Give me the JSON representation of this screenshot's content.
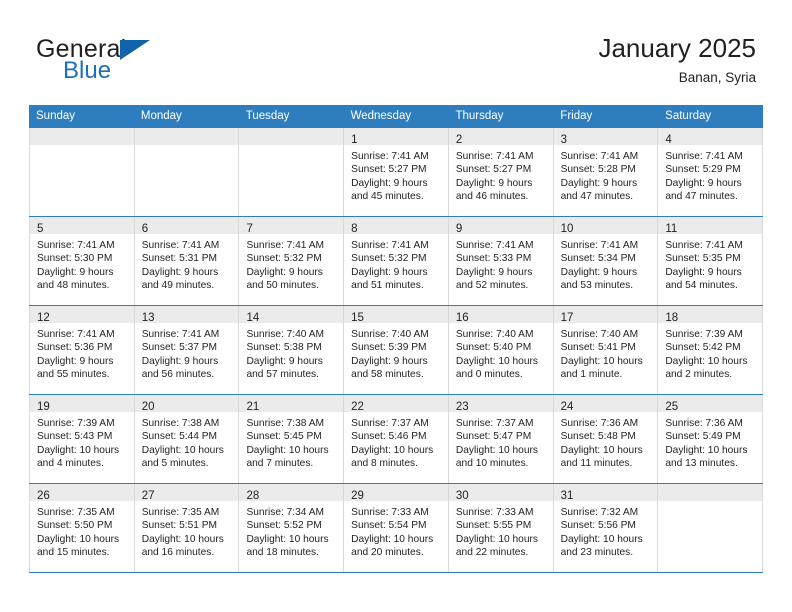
{
  "brand": {
    "name_top": "General",
    "name_bottom": "Blue",
    "accent_color": "#1163ac"
  },
  "header": {
    "title": "January 2025",
    "subtitle": "Banan, Syria"
  },
  "theme": {
    "header_blue": "#2e7ebf",
    "daynum_strip": "#ebebeb",
    "grid_line": "#d9d9d9",
    "text": "#231f20"
  },
  "calendar": {
    "day_names": [
      "Sunday",
      "Monday",
      "Tuesday",
      "Wednesday",
      "Thursday",
      "Friday",
      "Saturday"
    ],
    "labels": {
      "sunrise": "Sunrise:",
      "sunset": "Sunset:",
      "daylight": "Daylight:"
    },
    "weeks": [
      [
        {
          "day": "",
          "sunrise": "",
          "sunset": "",
          "daylight_1": "",
          "daylight_2": ""
        },
        {
          "day": "",
          "sunrise": "",
          "sunset": "",
          "daylight_1": "",
          "daylight_2": ""
        },
        {
          "day": "",
          "sunrise": "",
          "sunset": "",
          "daylight_1": "",
          "daylight_2": ""
        },
        {
          "day": "1",
          "sunrise": "Sunrise: 7:41 AM",
          "sunset": "Sunset: 5:27 PM",
          "daylight_1": "Daylight: 9 hours",
          "daylight_2": "and 45 minutes."
        },
        {
          "day": "2",
          "sunrise": "Sunrise: 7:41 AM",
          "sunset": "Sunset: 5:27 PM",
          "daylight_1": "Daylight: 9 hours",
          "daylight_2": "and 46 minutes."
        },
        {
          "day": "3",
          "sunrise": "Sunrise: 7:41 AM",
          "sunset": "Sunset: 5:28 PM",
          "daylight_1": "Daylight: 9 hours",
          "daylight_2": "and 47 minutes."
        },
        {
          "day": "4",
          "sunrise": "Sunrise: 7:41 AM",
          "sunset": "Sunset: 5:29 PM",
          "daylight_1": "Daylight: 9 hours",
          "daylight_2": "and 47 minutes."
        }
      ],
      [
        {
          "day": "5",
          "sunrise": "Sunrise: 7:41 AM",
          "sunset": "Sunset: 5:30 PM",
          "daylight_1": "Daylight: 9 hours",
          "daylight_2": "and 48 minutes."
        },
        {
          "day": "6",
          "sunrise": "Sunrise: 7:41 AM",
          "sunset": "Sunset: 5:31 PM",
          "daylight_1": "Daylight: 9 hours",
          "daylight_2": "and 49 minutes."
        },
        {
          "day": "7",
          "sunrise": "Sunrise: 7:41 AM",
          "sunset": "Sunset: 5:32 PM",
          "daylight_1": "Daylight: 9 hours",
          "daylight_2": "and 50 minutes."
        },
        {
          "day": "8",
          "sunrise": "Sunrise: 7:41 AM",
          "sunset": "Sunset: 5:32 PM",
          "daylight_1": "Daylight: 9 hours",
          "daylight_2": "and 51 minutes."
        },
        {
          "day": "9",
          "sunrise": "Sunrise: 7:41 AM",
          "sunset": "Sunset: 5:33 PM",
          "daylight_1": "Daylight: 9 hours",
          "daylight_2": "and 52 minutes."
        },
        {
          "day": "10",
          "sunrise": "Sunrise: 7:41 AM",
          "sunset": "Sunset: 5:34 PM",
          "daylight_1": "Daylight: 9 hours",
          "daylight_2": "and 53 minutes."
        },
        {
          "day": "11",
          "sunrise": "Sunrise: 7:41 AM",
          "sunset": "Sunset: 5:35 PM",
          "daylight_1": "Daylight: 9 hours",
          "daylight_2": "and 54 minutes."
        }
      ],
      [
        {
          "day": "12",
          "sunrise": "Sunrise: 7:41 AM",
          "sunset": "Sunset: 5:36 PM",
          "daylight_1": "Daylight: 9 hours",
          "daylight_2": "and 55 minutes."
        },
        {
          "day": "13",
          "sunrise": "Sunrise: 7:41 AM",
          "sunset": "Sunset: 5:37 PM",
          "daylight_1": "Daylight: 9 hours",
          "daylight_2": "and 56 minutes."
        },
        {
          "day": "14",
          "sunrise": "Sunrise: 7:40 AM",
          "sunset": "Sunset: 5:38 PM",
          "daylight_1": "Daylight: 9 hours",
          "daylight_2": "and 57 minutes."
        },
        {
          "day": "15",
          "sunrise": "Sunrise: 7:40 AM",
          "sunset": "Sunset: 5:39 PM",
          "daylight_1": "Daylight: 9 hours",
          "daylight_2": "and 58 minutes."
        },
        {
          "day": "16",
          "sunrise": "Sunrise: 7:40 AM",
          "sunset": "Sunset: 5:40 PM",
          "daylight_1": "Daylight: 10 hours",
          "daylight_2": "and 0 minutes."
        },
        {
          "day": "17",
          "sunrise": "Sunrise: 7:40 AM",
          "sunset": "Sunset: 5:41 PM",
          "daylight_1": "Daylight: 10 hours",
          "daylight_2": "and 1 minute."
        },
        {
          "day": "18",
          "sunrise": "Sunrise: 7:39 AM",
          "sunset": "Sunset: 5:42 PM",
          "daylight_1": "Daylight: 10 hours",
          "daylight_2": "and 2 minutes."
        }
      ],
      [
        {
          "day": "19",
          "sunrise": "Sunrise: 7:39 AM",
          "sunset": "Sunset: 5:43 PM",
          "daylight_1": "Daylight: 10 hours",
          "daylight_2": "and 4 minutes."
        },
        {
          "day": "20",
          "sunrise": "Sunrise: 7:38 AM",
          "sunset": "Sunset: 5:44 PM",
          "daylight_1": "Daylight: 10 hours",
          "daylight_2": "and 5 minutes."
        },
        {
          "day": "21",
          "sunrise": "Sunrise: 7:38 AM",
          "sunset": "Sunset: 5:45 PM",
          "daylight_1": "Daylight: 10 hours",
          "daylight_2": "and 7 minutes."
        },
        {
          "day": "22",
          "sunrise": "Sunrise: 7:37 AM",
          "sunset": "Sunset: 5:46 PM",
          "daylight_1": "Daylight: 10 hours",
          "daylight_2": "and 8 minutes."
        },
        {
          "day": "23",
          "sunrise": "Sunrise: 7:37 AM",
          "sunset": "Sunset: 5:47 PM",
          "daylight_1": "Daylight: 10 hours",
          "daylight_2": "and 10 minutes."
        },
        {
          "day": "24",
          "sunrise": "Sunrise: 7:36 AM",
          "sunset": "Sunset: 5:48 PM",
          "daylight_1": "Daylight: 10 hours",
          "daylight_2": "and 11 minutes."
        },
        {
          "day": "25",
          "sunrise": "Sunrise: 7:36 AM",
          "sunset": "Sunset: 5:49 PM",
          "daylight_1": "Daylight: 10 hours",
          "daylight_2": "and 13 minutes."
        }
      ],
      [
        {
          "day": "26",
          "sunrise": "Sunrise: 7:35 AM",
          "sunset": "Sunset: 5:50 PM",
          "daylight_1": "Daylight: 10 hours",
          "daylight_2": "and 15 minutes."
        },
        {
          "day": "27",
          "sunrise": "Sunrise: 7:35 AM",
          "sunset": "Sunset: 5:51 PM",
          "daylight_1": "Daylight: 10 hours",
          "daylight_2": "and 16 minutes."
        },
        {
          "day": "28",
          "sunrise": "Sunrise: 7:34 AM",
          "sunset": "Sunset: 5:52 PM",
          "daylight_1": "Daylight: 10 hours",
          "daylight_2": "and 18 minutes."
        },
        {
          "day": "29",
          "sunrise": "Sunrise: 7:33 AM",
          "sunset": "Sunset: 5:54 PM",
          "daylight_1": "Daylight: 10 hours",
          "daylight_2": "and 20 minutes."
        },
        {
          "day": "30",
          "sunrise": "Sunrise: 7:33 AM",
          "sunset": "Sunset: 5:55 PM",
          "daylight_1": "Daylight: 10 hours",
          "daylight_2": "and 22 minutes."
        },
        {
          "day": "31",
          "sunrise": "Sunrise: 7:32 AM",
          "sunset": "Sunset: 5:56 PM",
          "daylight_1": "Daylight: 10 hours",
          "daylight_2": "and 23 minutes."
        },
        {
          "day": "",
          "sunrise": "",
          "sunset": "",
          "daylight_1": "",
          "daylight_2": ""
        }
      ]
    ]
  }
}
